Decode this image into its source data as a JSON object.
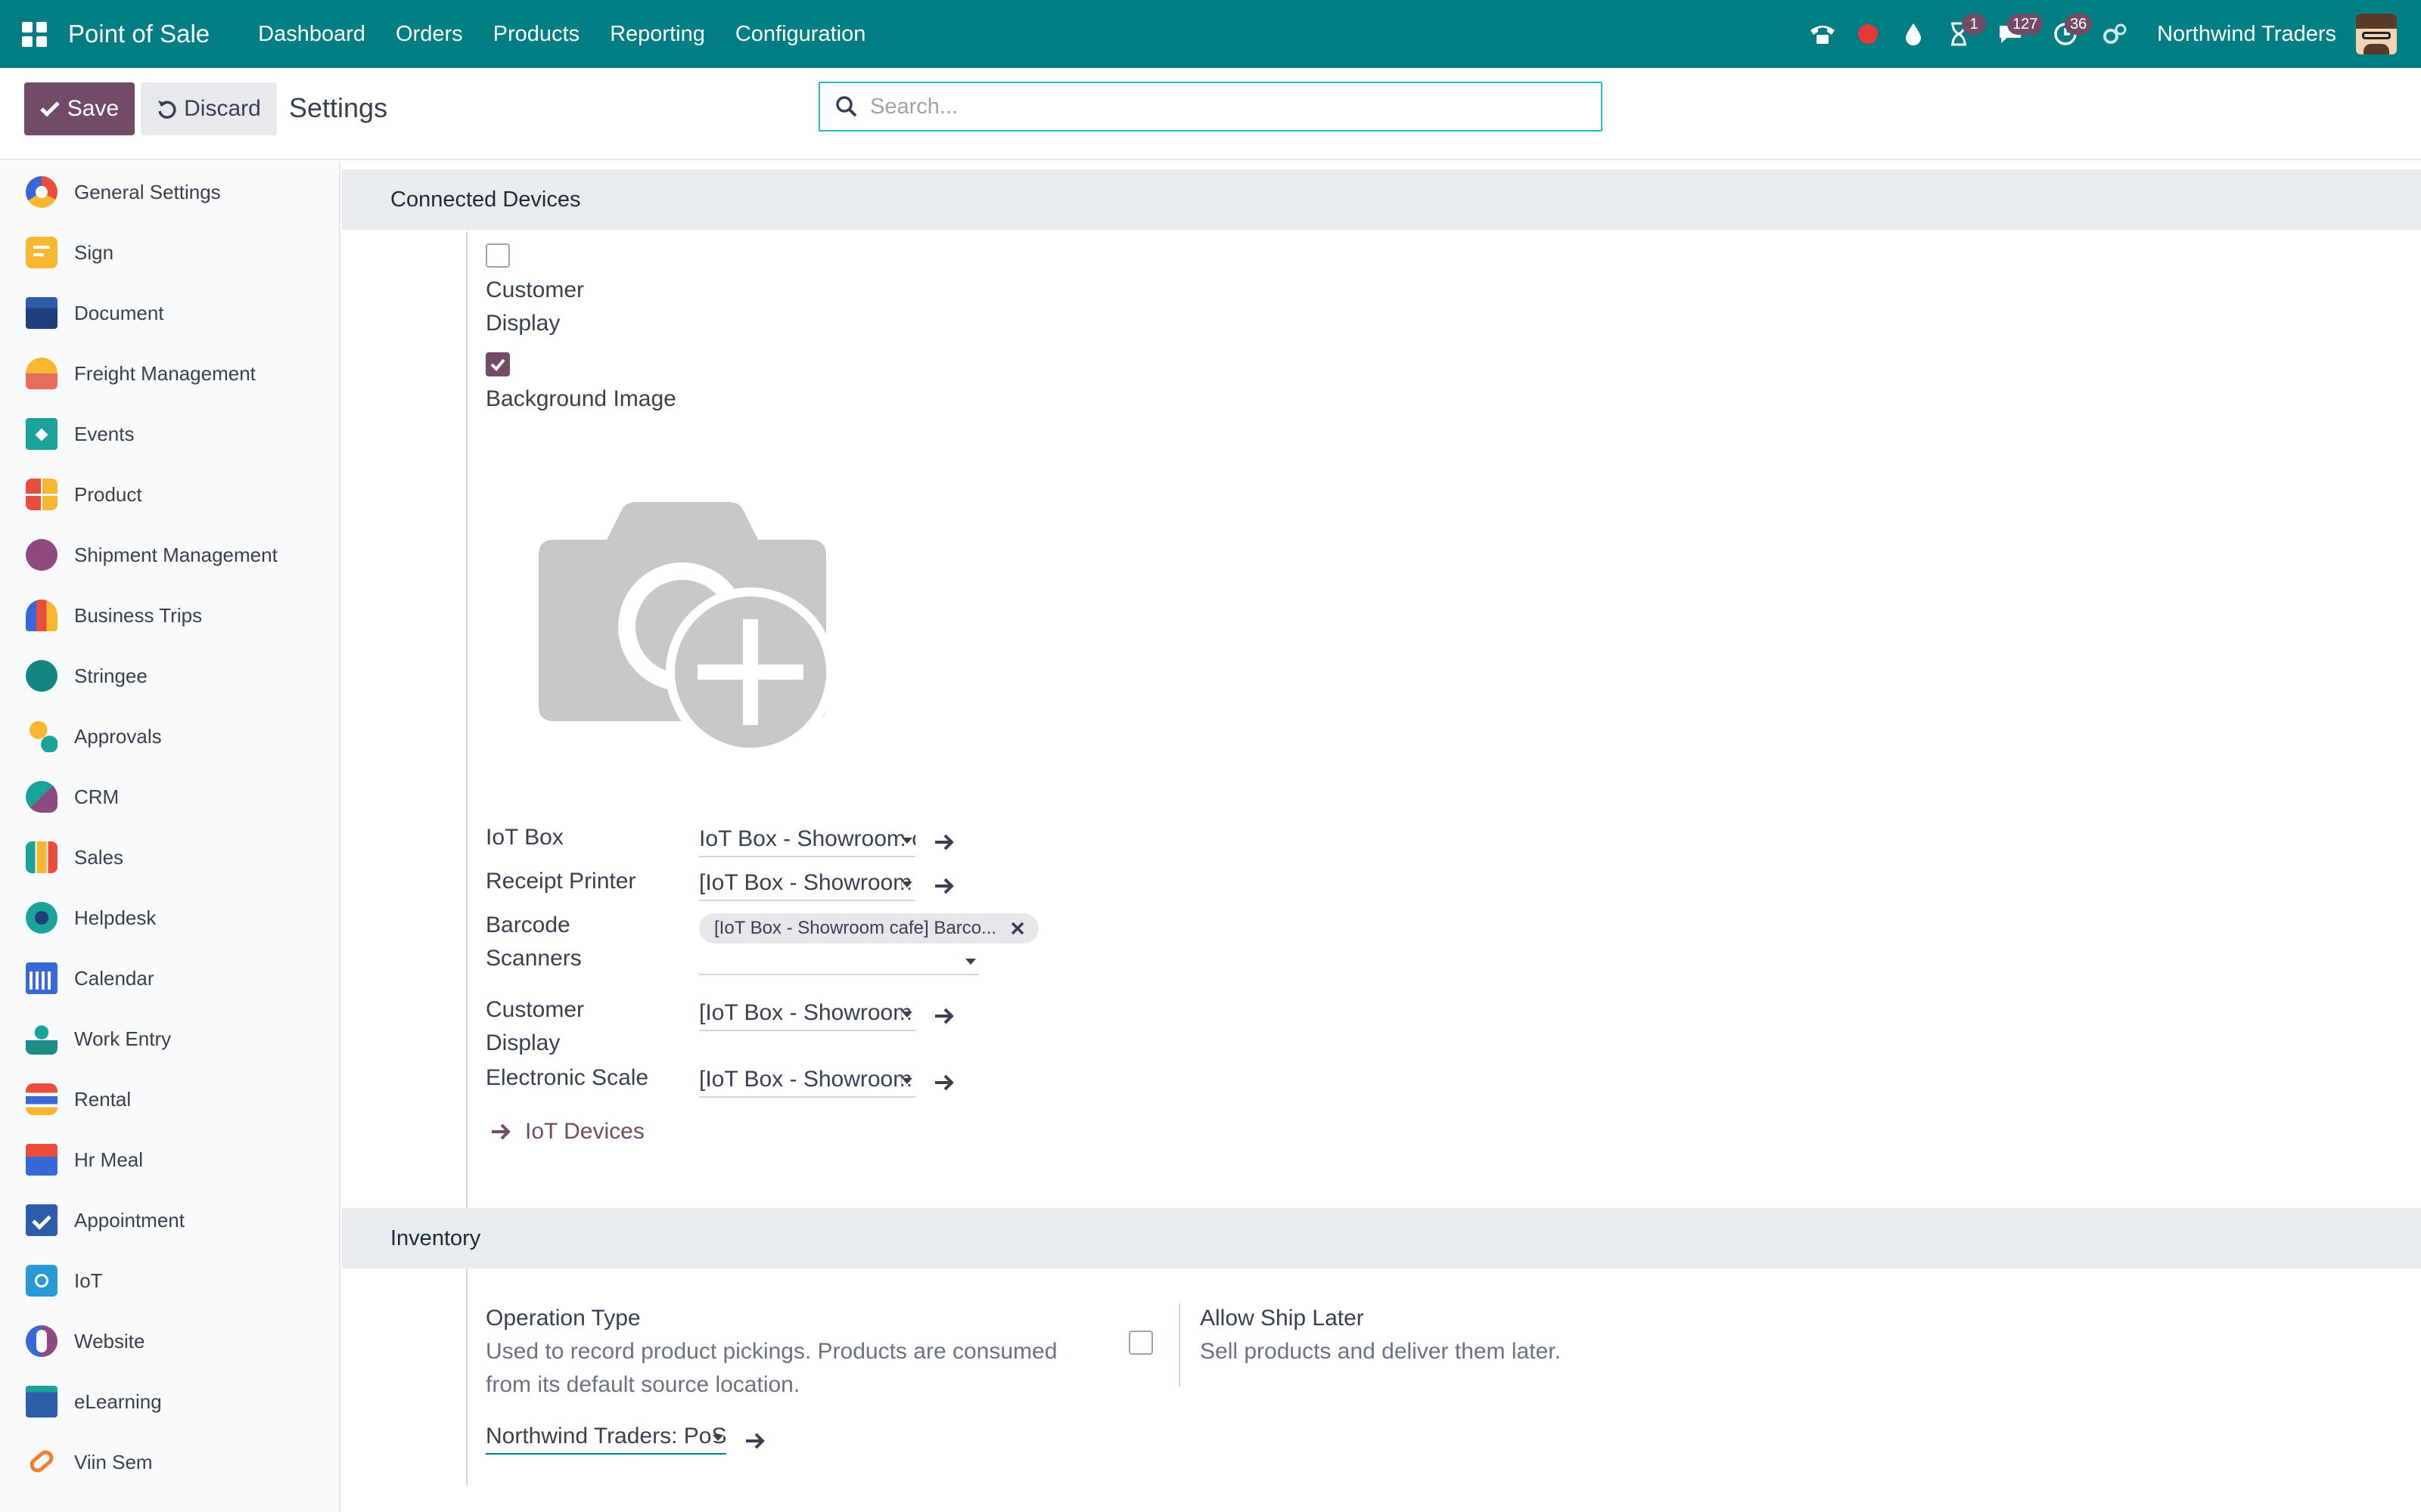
{
  "navbar": {
    "brand": "Point of Sale",
    "menu": [
      "Dashboard",
      "Orders",
      "Products",
      "Reporting",
      "Configuration"
    ],
    "badges": {
      "activity": "1",
      "messages": "127",
      "clock": "36"
    },
    "company": "Northwind Traders",
    "accent": "#017e84"
  },
  "control": {
    "save_label": "Save",
    "discard_label": "Discard",
    "title": "Settings",
    "search_placeholder": "Search..."
  },
  "sidebar": {
    "items": [
      {
        "label": "General Settings",
        "icon": "general-settings-icon"
      },
      {
        "label": "Sign",
        "icon": "sign-icon"
      },
      {
        "label": "Document",
        "icon": "document-icon"
      },
      {
        "label": "Freight Management",
        "icon": "freight-icon"
      },
      {
        "label": "Events",
        "icon": "events-icon"
      },
      {
        "label": "Product",
        "icon": "product-icon"
      },
      {
        "label": "Shipment Management",
        "icon": "shipment-icon"
      },
      {
        "label": "Business Trips",
        "icon": "business-trips-icon"
      },
      {
        "label": "Stringee",
        "icon": "stringee-icon"
      },
      {
        "label": "Approvals",
        "icon": "approvals-icon"
      },
      {
        "label": "CRM",
        "icon": "crm-icon"
      },
      {
        "label": "Sales",
        "icon": "sales-icon"
      },
      {
        "label": "Helpdesk",
        "icon": "helpdesk-icon"
      },
      {
        "label": "Calendar",
        "icon": "calendar-icon"
      },
      {
        "label": "Work Entry",
        "icon": "work-entry-icon"
      },
      {
        "label": "Rental",
        "icon": "rental-icon"
      },
      {
        "label": "Hr Meal",
        "icon": "hr-meal-icon"
      },
      {
        "label": "Appointment",
        "icon": "appointment-icon"
      },
      {
        "label": "IoT",
        "icon": "iot-icon"
      },
      {
        "label": "Website",
        "icon": "website-icon"
      },
      {
        "label": "eLearning",
        "icon": "elearning-icon"
      },
      {
        "label": "Viin Sem",
        "icon": "viin-sem-icon"
      }
    ]
  },
  "connected_devices": {
    "heading": "Connected Devices",
    "customer_display_line1": "Customer",
    "customer_display_line2": "Display",
    "customer_display_checked": false,
    "background_image_label": "Background Image",
    "background_image_checked": true,
    "fields": {
      "iot_box_label": "IoT Box",
      "iot_box_value": "IoT Box - Showroom cafe",
      "receipt_printer_label": "Receipt Printer",
      "receipt_printer_value": "[IoT Box - Showroom cafe] Printer",
      "barcode_label_line1": "Barcode",
      "barcode_label_line2": "Scanners",
      "barcode_tag": "[IoT Box - Showroom cafe] Barco...",
      "customer_display_label_line1": "Customer",
      "customer_display_label_line2": "Display",
      "customer_display_value": "[IoT Box - Showroom cafe] Display",
      "scale_label": "Electronic Scale",
      "scale_value": "[IoT Box - Showroom cafe] Scale"
    },
    "iot_devices_link": "IoT Devices"
  },
  "inventory": {
    "heading": "Inventory",
    "operation_type_label": "Operation Type",
    "operation_type_help_line1": "Used to record product pickings. Products are consumed",
    "operation_type_help_line2": "from its default source location.",
    "operation_type_value": "Northwind Traders: PoS Orders",
    "ship_later_label": "Allow Ship Later",
    "ship_later_help": "Sell products and deliver them later.",
    "ship_later_checked": false
  }
}
